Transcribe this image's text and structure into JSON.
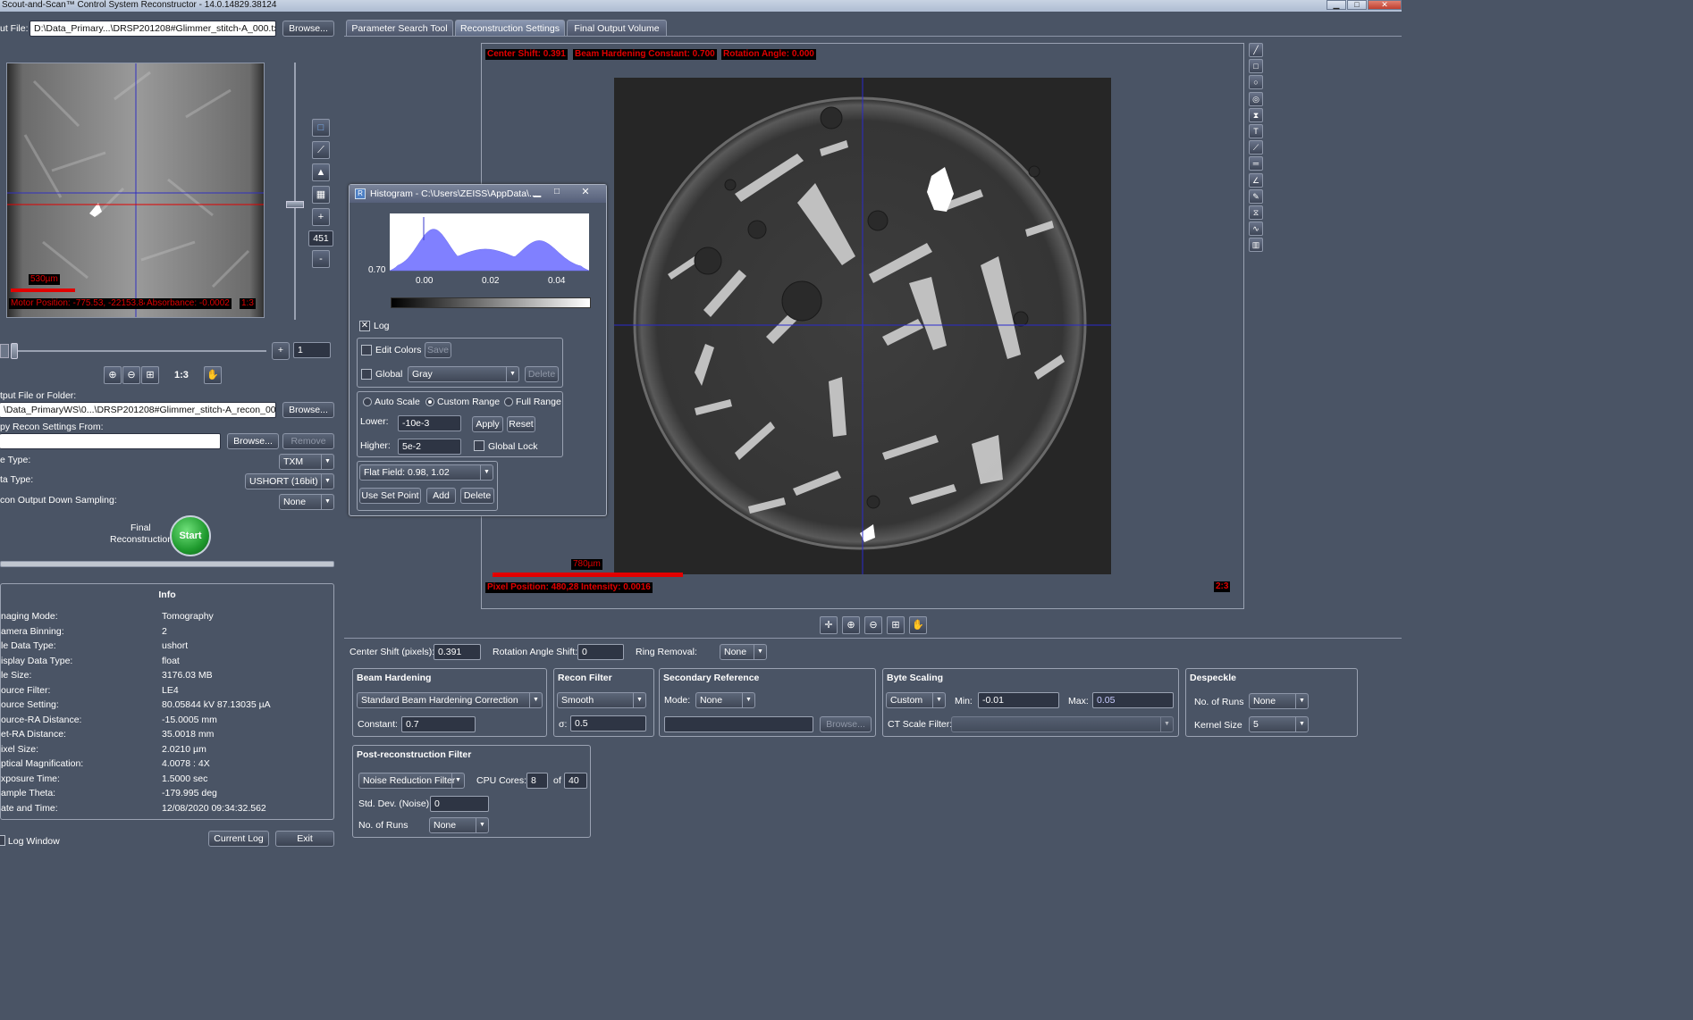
{
  "window": {
    "title": "Scout-and-Scan™ Control System Reconstructor - 14.0.14829.38124"
  },
  "left": {
    "input_file_label": "ut File:",
    "input_file_value": "D:\\Data_Primary...\\DRSP201208#Glimmer_stitch-A_000.txrm",
    "browse_label": "Browse...",
    "projection_overlay": {
      "scale_bar": "530µm",
      "motor_position": "Motor Position: -775.53, -22153.84",
      "absorbance": "Absorbance: -0.0002",
      "zoom": "1:3"
    },
    "side_tools": {
      "plus": "+",
      "minus": "-",
      "slider_value": "451"
    },
    "frame_value": "1",
    "frame_plus": "+",
    "zoom_ratio": "1:3",
    "output_label": "tput File or Folder:",
    "output_value": "\\Data_PrimaryWS\\0...\\DRSP201208#Glimmer_stitch-A_recon_000.txm",
    "copy_label": "py Recon Settings From:",
    "copy_value": "",
    "remove_label": "Remove",
    "file_type_label": "e Type:",
    "file_type_value": "TXM",
    "data_type_label": "ta Type:",
    "data_type_value": "USHORT (16bit)",
    "downsampling_label": "con Output Down Sampling:",
    "downsampling_value": "None",
    "final_recon_label_1": "Final",
    "final_recon_label_2": "Reconstruction",
    "start_label": "Start",
    "info_title": "Info",
    "info": [
      {
        "k": "naging Mode:",
        "v": "Tomography"
      },
      {
        "k": "amera Binning:",
        "v": "2"
      },
      {
        "k": "le Data Type:",
        "v": "ushort"
      },
      {
        "k": "isplay Data Type:",
        "v": "float"
      },
      {
        "k": "le Size:",
        "v": "3176.03 MB"
      },
      {
        "k": "ource Filter:",
        "v": "LE4"
      },
      {
        "k": "ource Setting:",
        "v": "80.05844 kV  87.13035 µA"
      },
      {
        "k": "ource-RA Distance:",
        "v": "-15.0005 mm"
      },
      {
        "k": "et-RA Distance:",
        "v": "35.0018 mm"
      },
      {
        "k": "ixel Size:",
        "v": "2.0210 µm"
      },
      {
        "k": "ptical Magnification:",
        "v": "4.0078 : 4X"
      },
      {
        "k": "xposure Time:",
        "v": "1.5000 sec"
      },
      {
        "k": "ample Theta:",
        "v": "-179.995 deg"
      },
      {
        "k": "ate and Time:",
        "v": "12/08/2020 09:34:32.562"
      }
    ],
    "log_window": "Log Window",
    "current_log": "Current Log",
    "exit": "Exit"
  },
  "tabs": [
    "Parameter Search Tool",
    "Reconstruction Settings",
    "Final Output Volume"
  ],
  "viewer": {
    "center_shift": "Center Shift: 0.391",
    "beam_hardening": "Beam Hardening Constant: 0.700",
    "rotation": "Rotation Angle: 0.000",
    "scale_bar": "780µm",
    "pixel_position": "Pixel Position: 480,28",
    "intensity": "Intensity: 0.0016",
    "zoom": "2:3"
  },
  "histogram": {
    "title": "Histogram - C:\\Users\\ZEISS\\AppData\\...",
    "y_label": "0.70",
    "x_ticks": [
      "0.00",
      "0.02",
      "0.04"
    ],
    "log_label": "Log",
    "edit_colors": "Edit Colors",
    "save": "Save",
    "global": "Global",
    "colormap": "Gray",
    "delete": "Delete",
    "auto_scale": "Auto Scale",
    "custom_range": "Custom Range",
    "full_range": "Full Range",
    "lower_label": "Lower:",
    "lower_value": "-10e-3",
    "higher_label": "Higher:",
    "higher_value": "5e-2",
    "apply": "Apply",
    "reset": "Reset",
    "global_lock": "Global Lock",
    "flat_field": "Flat Field: 0.98, 1.02",
    "use_set_point": "Use Set Point",
    "add": "Add",
    "delete2": "Delete"
  },
  "settings": {
    "center_shift_label": "Center Shift (pixels):",
    "center_shift_value": "0.391",
    "rotation_label": "Rotation Angle Shift:",
    "rotation_value": "0",
    "ring_label": "Ring Removal:",
    "ring_value": "None",
    "beam_title": "Beam Hardening",
    "beam_mode": "Standard Beam Hardening Correction",
    "constant_label": "Constant:",
    "constant_value": "0.7",
    "recon_title": "Recon Filter",
    "recon_filter": "Smooth",
    "sigma_label": "σ:",
    "sigma_value": "0.5",
    "secref_title": "Secondary Reference",
    "mode_label": "Mode:",
    "mode_value": "None",
    "secref_path": "",
    "browse_dis": "Browse...",
    "byte_title": "Byte Scaling",
    "byte_mode": "Custom",
    "min_label": "Min:",
    "min_value": "-0.01",
    "max_label": "Max:",
    "max_value": "0.05",
    "ct_label": "CT Scale Filter:",
    "ct_value": "",
    "despeckle_title": "Despeckle",
    "runs_label": "No. of Runs",
    "runs_value": "None",
    "kernel_label": "Kernel Size",
    "kernel_value": "5",
    "post_title": "Post-reconstruction Filter",
    "post_filter": "Noise Reduction Filter",
    "cpu_label": "CPU Cores:",
    "cpu_value": "8",
    "of_label": "of",
    "cpu_total": "40",
    "std_label": "Std. Dev. (Noise):",
    "std_value": "0",
    "post_runs_label": "No. of Runs",
    "post_runs_value": "None"
  },
  "colors": {
    "accent_red": "#e10000",
    "start_green": "#1f9a2e",
    "histogram_fill": "#8080ff"
  }
}
